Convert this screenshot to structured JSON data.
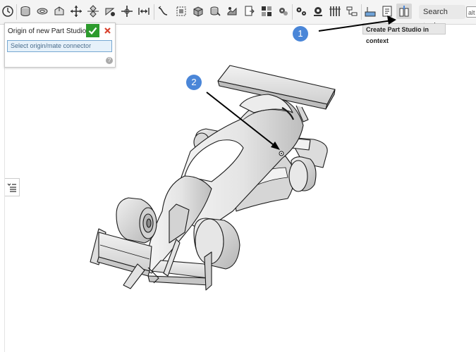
{
  "toolbar": {
    "icons": [
      "history-icon",
      "extrude-icon",
      "revolve-icon",
      "sweep-icon",
      "loft-icon",
      "thicken-icon",
      "fillet-icon",
      "chamfer-icon",
      "draft-icon",
      "shell-icon",
      "pattern-icon",
      "mirror-icon",
      "boolean-icon",
      "split-icon",
      "transform-icon",
      "plane-icon",
      "mate-connector-icon",
      "variable-icon",
      "gear-icon",
      "settings-gear-icon",
      "sheet-metal-icon",
      "frame-icon",
      "surface-icon",
      "export-icon",
      "create-part-studio-in-context-icon"
    ],
    "search_placeholder": "Search tools...",
    "search_shortcut": "alt"
  },
  "tooltip": {
    "text": "Create Part Studio in context"
  },
  "dialog": {
    "title": "Origin of new Part Studio",
    "input_placeholder": "Select origin/mate connector",
    "help": "?"
  },
  "annotations": {
    "badge_1": "1",
    "badge_2": "2"
  },
  "colors": {
    "accent_blue": "#4a86d8",
    "confirm_green": "#2d9b2d",
    "cancel_red": "#d9432f"
  }
}
